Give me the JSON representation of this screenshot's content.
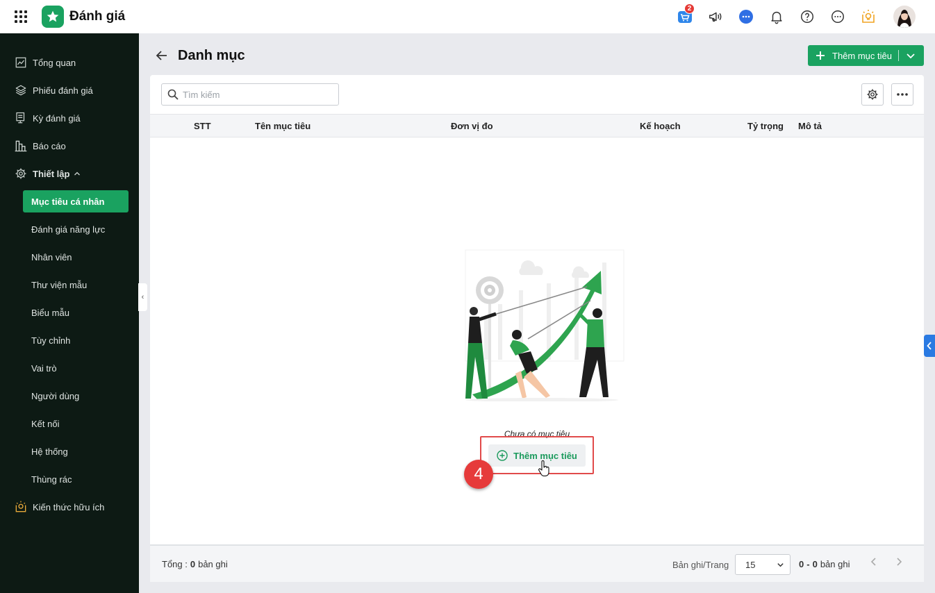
{
  "app": {
    "title": "Đánh giá"
  },
  "header": {
    "cart_badge": "2"
  },
  "sidebar": {
    "items": [
      {
        "label": "Tổng quan"
      },
      {
        "label": "Phiếu đánh giá"
      },
      {
        "label": "Kỳ đánh giá"
      },
      {
        "label": "Báo cáo"
      },
      {
        "label": "Thiết lập"
      }
    ],
    "sub_items": [
      {
        "label": "Mục tiêu cá nhân"
      },
      {
        "label": "Đánh giá năng lực"
      },
      {
        "label": "Nhân viên"
      },
      {
        "label": "Thư viện mẫu"
      },
      {
        "label": "Biểu mẫu"
      },
      {
        "label": "Tùy chỉnh"
      },
      {
        "label": "Vai trò"
      },
      {
        "label": "Người dùng"
      },
      {
        "label": "Kết nối"
      },
      {
        "label": "Hệ thống"
      },
      {
        "label": "Thùng rác"
      }
    ],
    "knowledge": "Kiến thức hữu ích"
  },
  "page": {
    "title": "Danh mục",
    "add_button": "Thêm mục tiêu"
  },
  "search": {
    "placeholder": "Tìm kiếm"
  },
  "table": {
    "columns": [
      "STT",
      "Tên mục tiêu",
      "Đơn vị đo",
      "Kế hoạch",
      "Tỷ trọng",
      "Mô tả"
    ]
  },
  "empty": {
    "text": "Chưa có mục tiêu",
    "add_label": "Thêm mục tiêu",
    "step": "4"
  },
  "footer": {
    "total_label": "Tổng :",
    "total_count": "0",
    "total_unit": "bản ghi",
    "per_page_label": "Bản ghi/Trang",
    "per_page_value": "15",
    "range_from": "0",
    "range_sep": "-",
    "range_to": "0",
    "range_unit": "bản ghi"
  },
  "colors": {
    "accent": "#1aa260",
    "sidebar_bg": "#0d1a14",
    "highlight": "#e14a4a"
  }
}
